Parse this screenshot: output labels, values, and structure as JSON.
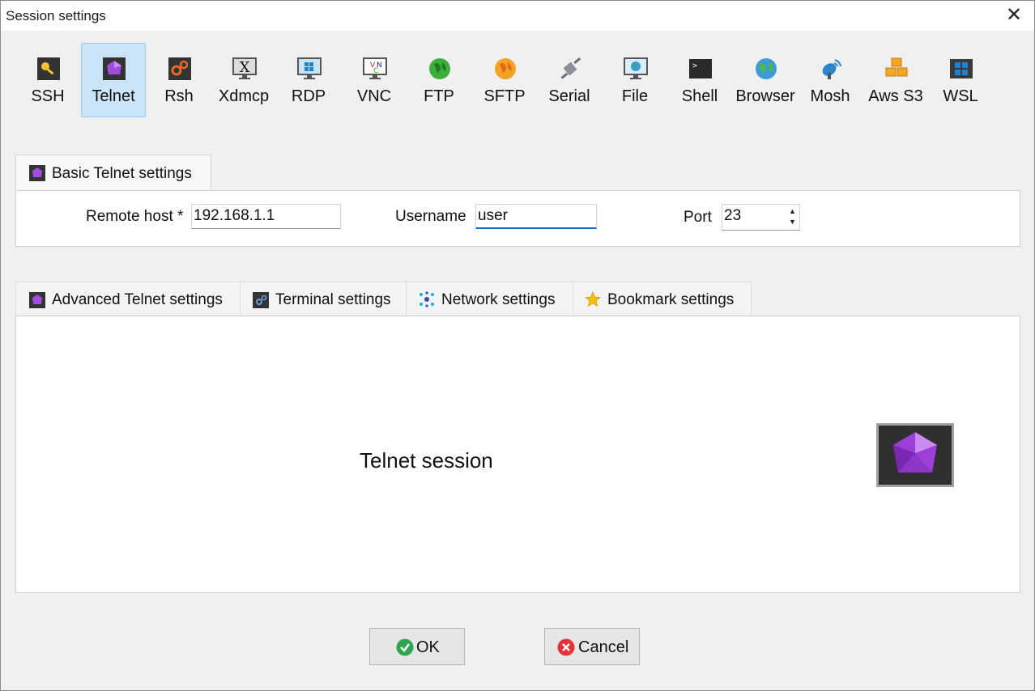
{
  "window": {
    "title": "Session settings",
    "close_glyph": "✕"
  },
  "toolbar": {
    "items": [
      {
        "label": "SSH",
        "icon": "key-icon"
      },
      {
        "label": "Telnet",
        "icon": "telnet-gem-icon",
        "selected": true
      },
      {
        "label": "Rsh",
        "icon": "rsh-gears-icon"
      },
      {
        "label": "Xdmcp",
        "icon": "xdmcp-monitor-icon"
      },
      {
        "label": "RDP",
        "icon": "rdp-monitor-icon"
      },
      {
        "label": "VNC",
        "icon": "vnc-monitor-icon"
      },
      {
        "label": "FTP",
        "icon": "ftp-globe-icon"
      },
      {
        "label": "SFTP",
        "icon": "sftp-globe-icon"
      },
      {
        "label": "Serial",
        "icon": "serial-plug-icon"
      },
      {
        "label": "File",
        "icon": "file-monitor-icon"
      },
      {
        "label": "Shell",
        "icon": "shell-terminal-icon"
      },
      {
        "label": "Browser",
        "icon": "browser-globe-icon"
      },
      {
        "label": "Mosh",
        "icon": "mosh-satellite-icon"
      },
      {
        "label": "Aws S3",
        "icon": "aws-s3-cubes-icon"
      },
      {
        "label": "WSL",
        "icon": "wsl-windows-icon"
      }
    ]
  },
  "basic": {
    "tab_label": "Basic Telnet settings",
    "remote_host_label": "Remote host *",
    "remote_host_value": "192.168.1.1",
    "username_label": "Username",
    "username_value": "user",
    "port_label": "Port",
    "port_value": "23"
  },
  "tabs": [
    {
      "label": "Advanced Telnet settings",
      "icon": "telnet-gem-icon"
    },
    {
      "label": "Terminal settings",
      "icon": "terminal-gears-icon"
    },
    {
      "label": "Network settings",
      "icon": "network-dots-icon"
    },
    {
      "label": "Bookmark settings",
      "icon": "star-icon"
    }
  ],
  "main": {
    "session_text": "Telnet session",
    "icon": "telnet-gem-icon"
  },
  "buttons": {
    "ok_label": "OK",
    "cancel_label": "Cancel"
  },
  "colors": {
    "selected_bg": "#cce4f7",
    "accent": "#1a66c8",
    "gem": "#9b3fd6"
  }
}
